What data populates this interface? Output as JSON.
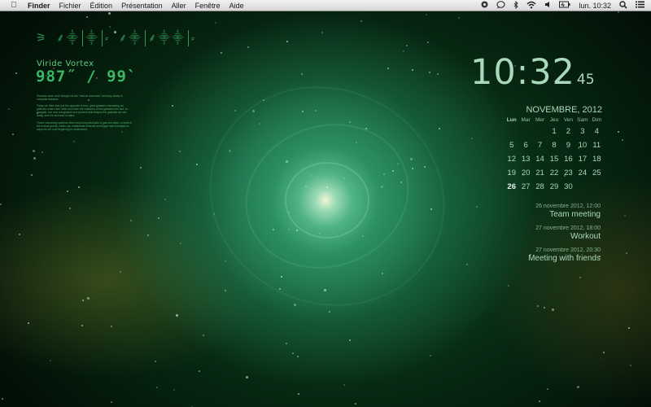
{
  "menubar": {
    "apple_icon": "apple-logo-icon",
    "app_name": "Finder",
    "menus": [
      "Fichier",
      "Édition",
      "Présentation",
      "Aller",
      "Fenêtre",
      "Aide"
    ],
    "status_icons": [
      "record-icon",
      "chat-bubble-icon",
      "bluetooth-icon",
      "wifi-icon",
      "volume-icon",
      "battery-icon"
    ],
    "clock": "lun. 10:32",
    "spotlight_icon": "search-icon",
    "notifications_icon": "list-icon"
  },
  "widget_left": {
    "glyph_row": [
      "⚞ ⸙⸎",
      "⸎",
      "⸗ ⸙⸎",
      "⸙⸎⸎",
      "⸗"
    ],
    "title": "Viride Vortex",
    "coordinates": "987˝ / 99`",
    "paragraphs": [
      "Seconds were once thought as the \"eternal universes\" evolving slowly in complete isolation.",
      "Today we think that just the opposite is true: great galaxies interacting, as galaxies crash each other and even the collisions of two galaxies into one, to navigate, are now recognized as a process that shapes the galaxies we see today, and the structure of stars.",
      "These interacting systems often boost long tidal tails of gas and stars, a result of the mutual gravity, which can redistribute material and trigger star formation in ways we are only beginning to understand."
    ]
  },
  "clock": {
    "hours_minutes": "10:32",
    "seconds": "45"
  },
  "calendar": {
    "month_title": "NOVEMBRE, 2012",
    "weekdays": [
      "Lun",
      "Mar",
      "Mer",
      "Jeu",
      "Ven",
      "Sam",
      "Dim"
    ],
    "leading_blanks": 3,
    "days": [
      "1",
      "2",
      "3",
      "4",
      "5",
      "6",
      "7",
      "8",
      "9",
      "10",
      "11",
      "12",
      "13",
      "14",
      "15",
      "16",
      "17",
      "18",
      "19",
      "20",
      "21",
      "22",
      "23",
      "24",
      "25",
      "26",
      "27",
      "28",
      "29",
      "30"
    ],
    "today": "26"
  },
  "events": [
    {
      "timestamp": "26 novembre 2012, 12:00",
      "title": "Team meeting"
    },
    {
      "timestamp": "27 novembre 2012, 18:00",
      "title": "Workout"
    },
    {
      "timestamp": "27 novembre 2012, 20:30",
      "title": "Meeting with friends"
    }
  ],
  "colors": {
    "widget_text": "#a9d8bd",
    "left_widget_green": "#3bb864",
    "menubar_bg": "#e4e4e4"
  }
}
